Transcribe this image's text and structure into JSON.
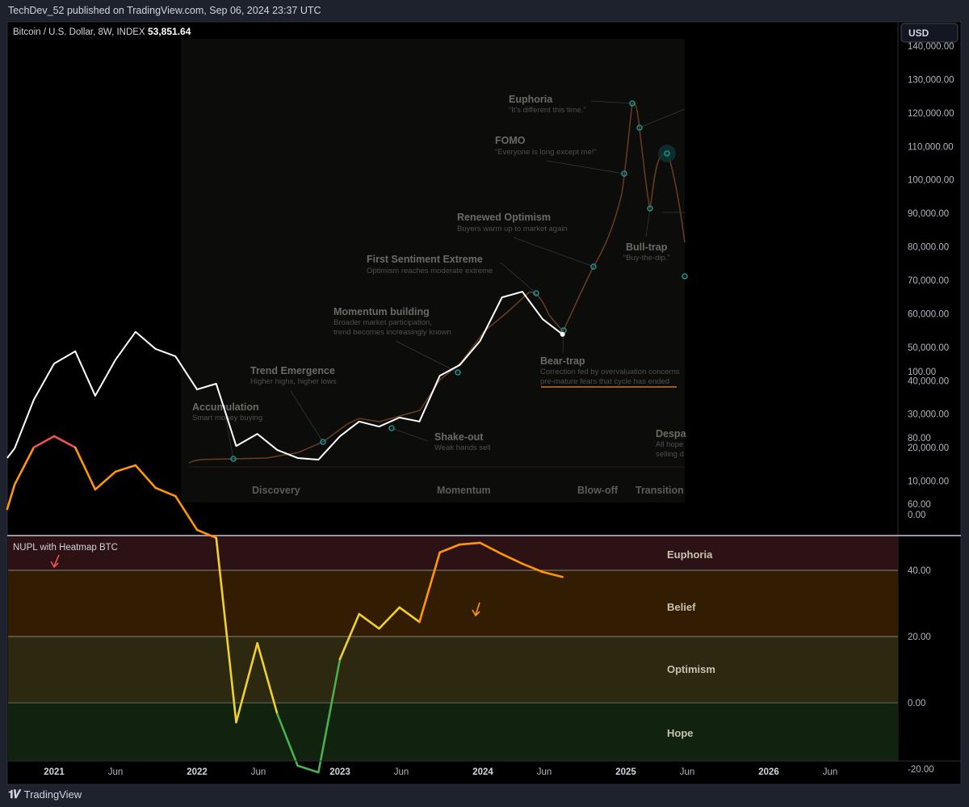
{
  "header": {
    "published": "TechDev_52 published on TradingView.com, Sep 06, 2024 23:37 UTC"
  },
  "legend": {
    "symbol": "Bitcoin / U.S. Dollar, 8W, INDEX",
    "last_price": "53,851.64"
  },
  "currency_button": "USD",
  "price_axis": [
    "140,000.00",
    "130,000.00",
    "120,000.00",
    "110,000.00",
    "100,000.00",
    "90,000.00",
    "80,000.00",
    "70,000.00",
    "60,000.00",
    "50,000.00",
    "40,000.00",
    "30,000.00",
    "20,000.00",
    "10,000.00",
    "0.00"
  ],
  "nupl_axis": [
    "100.00",
    "80.00",
    "60.00",
    "40.00",
    "20.00",
    "0.00",
    "-20.00"
  ],
  "time_axis": [
    "2021",
    "Jun",
    "2022",
    "Jun",
    "2023",
    "Jun",
    "2024",
    "Jun",
    "2025",
    "Jun",
    "2026",
    "Jun"
  ],
  "indicator": {
    "title": "NUPL with Heatmap BTC",
    "zones": [
      "Euphoria",
      "Belief",
      "Optimism",
      "Hope"
    ]
  },
  "overlay": {
    "annotations": [
      {
        "title": "Accumulation",
        "sub": "Smart money buying"
      },
      {
        "title": "Trend Emergence",
        "sub": "Higher highs, higher lows"
      },
      {
        "title": "Momentum building",
        "sub": "Broader market participation,",
        "sub2": "trend becomes increasingly known"
      },
      {
        "title": "First Sentiment Extreme",
        "sub": "Optimism reaches moderate extreme"
      },
      {
        "title": "Shake-out",
        "sub": "Weak hands sell"
      },
      {
        "title": "Renewed Optimism",
        "sub": "Buyers warm up to market again"
      },
      {
        "title": "FOMO",
        "sub": "“Everyone is long except me!”"
      },
      {
        "title": "Euphoria",
        "sub": "“It's different this time.”"
      },
      {
        "title": "Bull-trap",
        "sub": "“Buy-the-dip.”"
      },
      {
        "title": "Bear-trap",
        "sub": "Correction fed by overvaluation concerns",
        "sub2": "pre-mature fears that cycle has ended"
      },
      {
        "title": "Despa",
        "sub": "All hope",
        "sub2": "selling d"
      }
    ],
    "phases": [
      "Discovery",
      "Momentum",
      "Blow-off",
      "Transition"
    ]
  },
  "footer": {
    "brand": "TradingView",
    "logo": "TV"
  },
  "colors": {
    "price_line": "#ffffff",
    "euphoria": "#f05050",
    "belief": "#ff9800",
    "optimism": "#f0d22a",
    "hope": "#4caf50",
    "accent_underline": "#c8732a",
    "marker": "#1c8c8c"
  },
  "chart_data": [
    {
      "type": "line",
      "title": "Bitcoin / U.S. Dollar, 8W, INDEX",
      "ylabel": "USD",
      "ylim": [
        0,
        140000
      ],
      "x_range": [
        "2020-09",
        "2026-12"
      ],
      "grid": false,
      "points": [
        [
          "2020-09-03",
          16900
        ],
        [
          "2020-09-22",
          19800
        ],
        [
          "2020-11-10",
          34300
        ],
        [
          "2021-01-01",
          45100
        ],
        [
          "2021-02-24",
          48800
        ],
        [
          "2021-04-16",
          35500
        ],
        [
          "2021-06-07",
          46300
        ],
        [
          "2021-07-28",
          54600
        ],
        [
          "2021-09-17",
          49500
        ],
        [
          "2021-11-07",
          47300
        ],
        [
          "2022-01-01",
          37400
        ],
        [
          "2022-02-19",
          39100
        ],
        [
          "2022-04-11",
          20500
        ],
        [
          "2022-06-04",
          24100
        ],
        [
          "2022-07-25",
          19300
        ],
        [
          "2022-09-15",
          16900
        ],
        [
          "2022-11-07",
          16400
        ],
        [
          "2023-01-01",
          23400
        ],
        [
          "2023-02-19",
          27800
        ],
        [
          "2023-04-11",
          26300
        ],
        [
          "2023-06-02",
          29000
        ],
        [
          "2023-07-23",
          27800
        ],
        [
          "2023-09-13",
          41500
        ],
        [
          "2023-11-03",
          44700
        ],
        [
          "2023-12-25",
          51900
        ],
        [
          "2024-02-19",
          64900
        ],
        [
          "2024-04-11",
          66600
        ],
        [
          "2024-06-02",
          58400
        ],
        [
          "2024-07-23",
          53851.64
        ]
      ]
    },
    {
      "type": "line",
      "title": "NUPL with Heatmap BTC",
      "ylim": [
        -25,
        100
      ],
      "zone_bounds": [
        80,
        40,
        0
      ],
      "points": [
        [
          "2020-09-03",
          58.5
        ],
        [
          "2020-09-22",
          65.9
        ],
        [
          "2020-11-10",
          77.1
        ],
        [
          "2021-01-01",
          80.5
        ],
        [
          "2021-02-24",
          77.1
        ],
        [
          "2021-04-16",
          64.4
        ],
        [
          "2021-06-07",
          69.8
        ],
        [
          "2021-07-28",
          71.7
        ],
        [
          "2021-09-17",
          64.9
        ],
        [
          "2021-11-07",
          62.4
        ],
        [
          "2022-01-01",
          52.2
        ],
        [
          "2022-02-19",
          49.8
        ],
        [
          "2022-04-11",
          -5.9
        ],
        [
          "2022-06-04",
          18.0
        ],
        [
          "2022-07-25",
          -3.4
        ],
        [
          "2022-09-15",
          -19.0
        ],
        [
          "2022-11-07",
          -21.0
        ],
        [
          "2023-01-01",
          13.2
        ],
        [
          "2023-02-19",
          26.8
        ],
        [
          "2023-04-11",
          22.4
        ],
        [
          "2023-06-02",
          28.8
        ],
        [
          "2023-07-23",
          24.4
        ],
        [
          "2023-09-13",
          45.4
        ],
        [
          "2023-11-03",
          47.8
        ],
        [
          "2023-12-25",
          48.3
        ],
        [
          "2024-02-19",
          44.9
        ],
        [
          "2024-04-11",
          42.0
        ],
        [
          "2024-06-02",
          39.5
        ],
        [
          "2024-07-23",
          38.0
        ]
      ]
    }
  ]
}
